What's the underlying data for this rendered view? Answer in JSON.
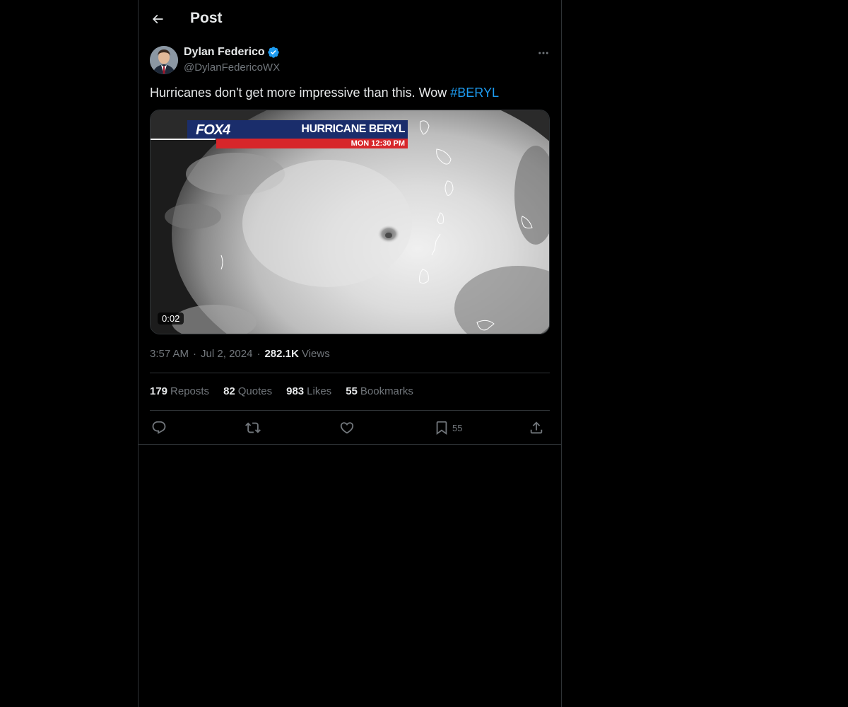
{
  "header": {
    "title": "Post"
  },
  "post": {
    "author_name": "Dylan Federico",
    "author_handle": "@DylanFedericoWX",
    "text": "Hurricanes don't get more impressive than this. Wow ",
    "hashtag": "#BERYL",
    "media": {
      "logo": "FOX4",
      "banner_title": "HURRICANE BERYL",
      "banner_time": "MON   12:30 PM",
      "duration": "0:02"
    },
    "time": "3:57 AM",
    "date": "Jul 2, 2024",
    "views_count": "282.1K",
    "views_label": "Views",
    "separator": "·"
  },
  "stats": {
    "reposts_count": "179",
    "reposts_label": "Reposts",
    "quotes_count": "82",
    "quotes_label": "Quotes",
    "likes_count": "983",
    "likes_label": "Likes",
    "bookmarks_count": "55",
    "bookmarks_label": "Bookmarks"
  },
  "actions": {
    "bookmark_count": "55",
    "icons": [
      "reply-icon",
      "repost-icon",
      "like-icon",
      "bookmark-icon",
      "share-icon"
    ]
  },
  "colors": {
    "background": "#000000",
    "text": "#e7e9ea",
    "muted": "#71767b",
    "accent": "#1d9bf0",
    "border": "#2f3336"
  }
}
